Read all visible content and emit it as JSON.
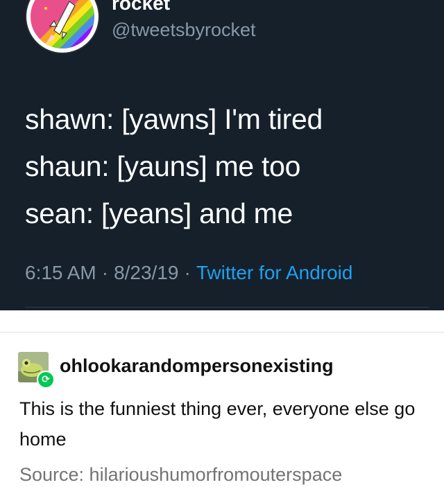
{
  "tweet": {
    "display_name": "rocket",
    "handle": "@tweetsbyrocket",
    "lines": [
      "shawn: [yawns] I'm tired",
      "shaun: [yauns] me too",
      "sean: [yeans] and me"
    ],
    "time": "6:15 AM",
    "date": "8/23/19",
    "separator": "·",
    "client": "Twitter for Android",
    "avatar_icon": "space-shuttle-rainbow-icon",
    "colors": {
      "background": "#15202b",
      "text": "#ffffff",
      "muted": "#8899a6",
      "link": "#1da1f2"
    }
  },
  "reblog": {
    "username": "ohlookarandompersonexisting",
    "avatar_icon": "frog-icon",
    "badge_icon": "reblog-icon",
    "comment": "This is the funniest thing ever, everyone else go home",
    "source": "Source: hilarioushumorfromouterspace",
    "colors": {
      "badge": "#00c853",
      "source": "#737373"
    }
  }
}
